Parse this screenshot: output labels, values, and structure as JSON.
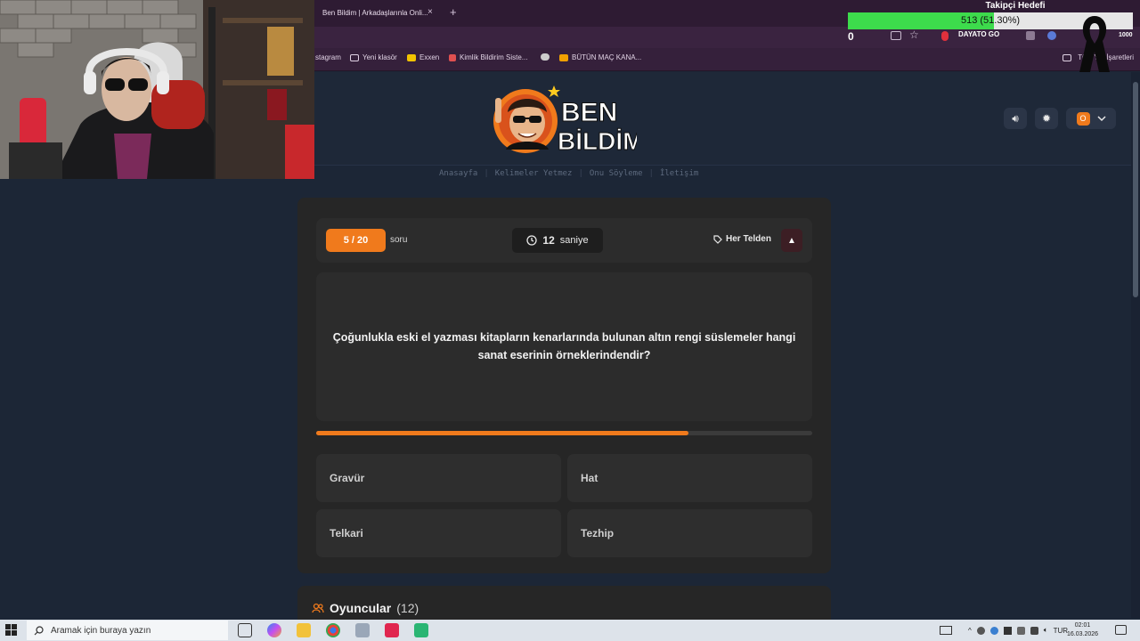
{
  "browser": {
    "tab_title": "Ben Bildim | Arkadaşlarınla Onli...",
    "tab_close": "×",
    "new_tab": "+",
    "bookmarks": [
      {
        "label": "stagram",
        "color": "#d6487a"
      },
      {
        "label": "Yeni klasör",
        "color": "#e8d7a0"
      },
      {
        "label": "Exxen",
        "color": "#f2c300"
      },
      {
        "label": "Kimlik Bildirim Siste...",
        "color": "#e05050"
      },
      {
        "label": "",
        "color": "#cccccc"
      },
      {
        "label": "BÜTÜN MAÇ KANA...",
        "color": "#f0a000"
      },
      {
        "label": "Tüm Yer İşaretleri",
        "color": "#e8d7a0"
      }
    ]
  },
  "overlay": {
    "goal_title": "Takipçi Hedefi",
    "goal_text": "513 (51.30%)",
    "goal_percent": 51.3,
    "counter": "0",
    "ticker": "DAYATO GO",
    "end_value": "1000"
  },
  "site": {
    "logo_line1": "BEN",
    "logo_line2": "BİLDİM",
    "nav": [
      "Anasayfa",
      "Kelimeler Yetmez",
      "Onu Söyleme",
      "İletişim"
    ],
    "user_initial": "O"
  },
  "game": {
    "question_number": "5 / 20",
    "question_unit": "soru",
    "timer_value": "12",
    "timer_unit": "saniye",
    "category": "Her Telden",
    "question": "Çoğunlukla eski el yazması kitapların kenarlarında bulunan altın rengi süslemeler hangi sanat eserinin örneklerindendir?",
    "progress_percent": 75,
    "answers": [
      "Gravür",
      "Hat",
      "Telkari",
      "Tezhip"
    ]
  },
  "players": {
    "title": "Oyuncular",
    "count": "(12)"
  },
  "taskbar": {
    "search_placeholder": "Aramak için buraya yazın",
    "language": "TUR",
    "time": "02:01",
    "date": "16.03.2026"
  },
  "colors": {
    "accent": "#f07a1c",
    "page_bg": "#1c2636",
    "card_bg": "#262626",
    "goal_fill": "#3ddb4c"
  }
}
